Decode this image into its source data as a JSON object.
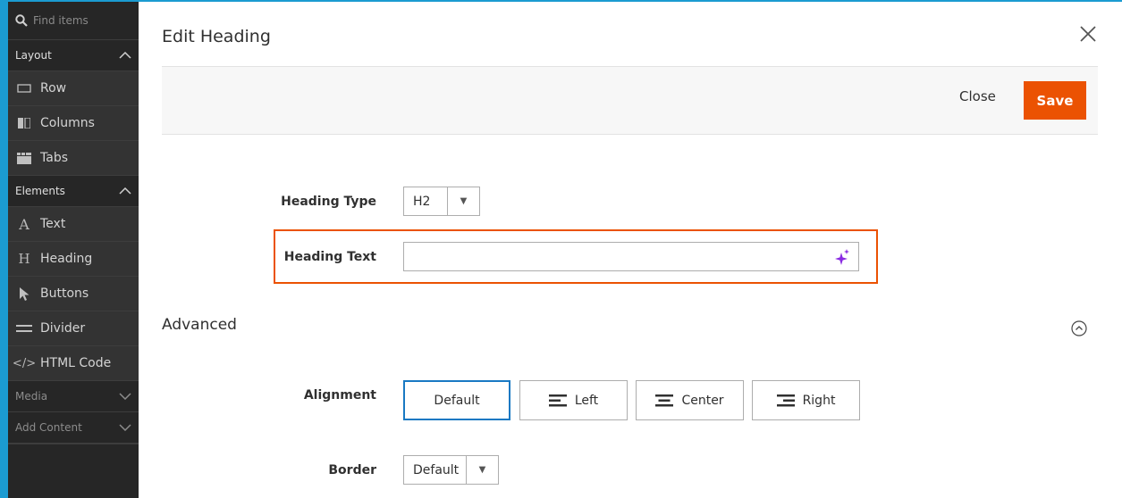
{
  "sidebar": {
    "search_placeholder": "Find items",
    "sections": {
      "layout": "Layout",
      "elements": "Elements",
      "media": "Media",
      "add_content": "Add Content"
    },
    "layout_items": [
      {
        "label": "Row",
        "icon": "row-icon"
      },
      {
        "label": "Columns",
        "icon": "columns-icon"
      },
      {
        "label": "Tabs",
        "icon": "tabs-icon"
      }
    ],
    "element_items": [
      {
        "label": "Text",
        "icon": "text-icon"
      },
      {
        "label": "Heading",
        "icon": "heading-icon"
      },
      {
        "label": "Buttons",
        "icon": "pointer-icon"
      },
      {
        "label": "Divider",
        "icon": "divider-icon"
      },
      {
        "label": "HTML Code",
        "icon": "code-icon"
      }
    ]
  },
  "modal": {
    "title": "Edit Heading",
    "close_label": "Close",
    "save_label": "Save"
  },
  "form": {
    "heading_type_label": "Heading Type",
    "heading_type_value": "H2",
    "heading_text_label": "Heading Text",
    "heading_text_value": "",
    "advanced_title": "Advanced",
    "alignment_label": "Alignment",
    "alignment_options": [
      "Default",
      "Left",
      "Center",
      "Right"
    ],
    "alignment_selected": "Default",
    "border_label": "Border",
    "border_value": "Default"
  },
  "colors": {
    "accent": "#eb5202",
    "selected": "#1979c3",
    "sidebar_bg": "#303030",
    "frame": "#1b9bd1"
  }
}
